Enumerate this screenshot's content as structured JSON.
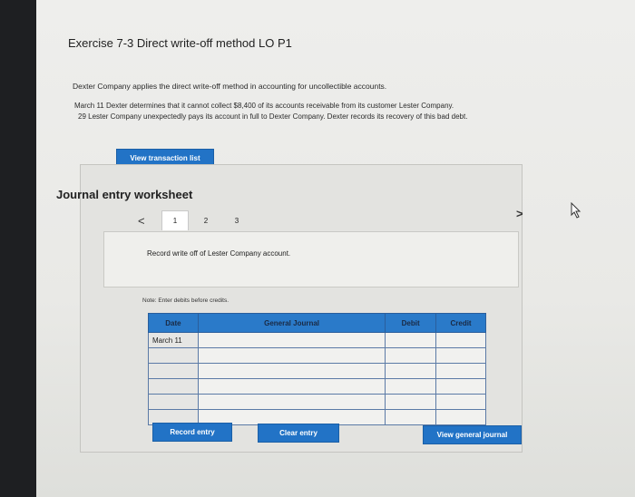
{
  "exercise_title": "Exercise 7-3 Direct write-off method LO P1",
  "intro_text": "Dexter Company applies the direct write-off method in accounting for uncollectible accounts.",
  "transactions": [
    {
      "date": "March 11",
      "text": "Dexter determines that it cannot collect $8,400 of its accounts receivable from its customer Lester Company."
    },
    {
      "date": "29",
      "text": "Lester Company unexpectedly pays its account in full to Dexter Company. Dexter records its recovery of this bad debt."
    }
  ],
  "buttons": {
    "view_transactions": "View transaction list",
    "record_entry": "Record entry",
    "clear_entry": "Clear entry",
    "view_general_journal": "View general journal"
  },
  "worksheet": {
    "title": "Journal entry worksheet",
    "tabs": [
      "1",
      "2",
      "3"
    ],
    "active_tab": "1",
    "prev_symbol": "<",
    "next_symbol": ">",
    "prompt": "Record write off of Lester Company account.",
    "note": "Note: Enter debits before credits."
  },
  "journal": {
    "headers": [
      "Date",
      "General Journal",
      "Debit",
      "Credit"
    ],
    "rows": [
      [
        "March 11",
        "",
        "",
        ""
      ],
      [
        "",
        "",
        "",
        ""
      ],
      [
        "",
        "",
        "",
        ""
      ],
      [
        "",
        "",
        "",
        ""
      ],
      [
        "",
        "",
        "",
        ""
      ],
      [
        "",
        "",
        "",
        ""
      ]
    ]
  },
  "colors": {
    "accent": "#2273c6",
    "table_header": "#2a7ac9"
  }
}
